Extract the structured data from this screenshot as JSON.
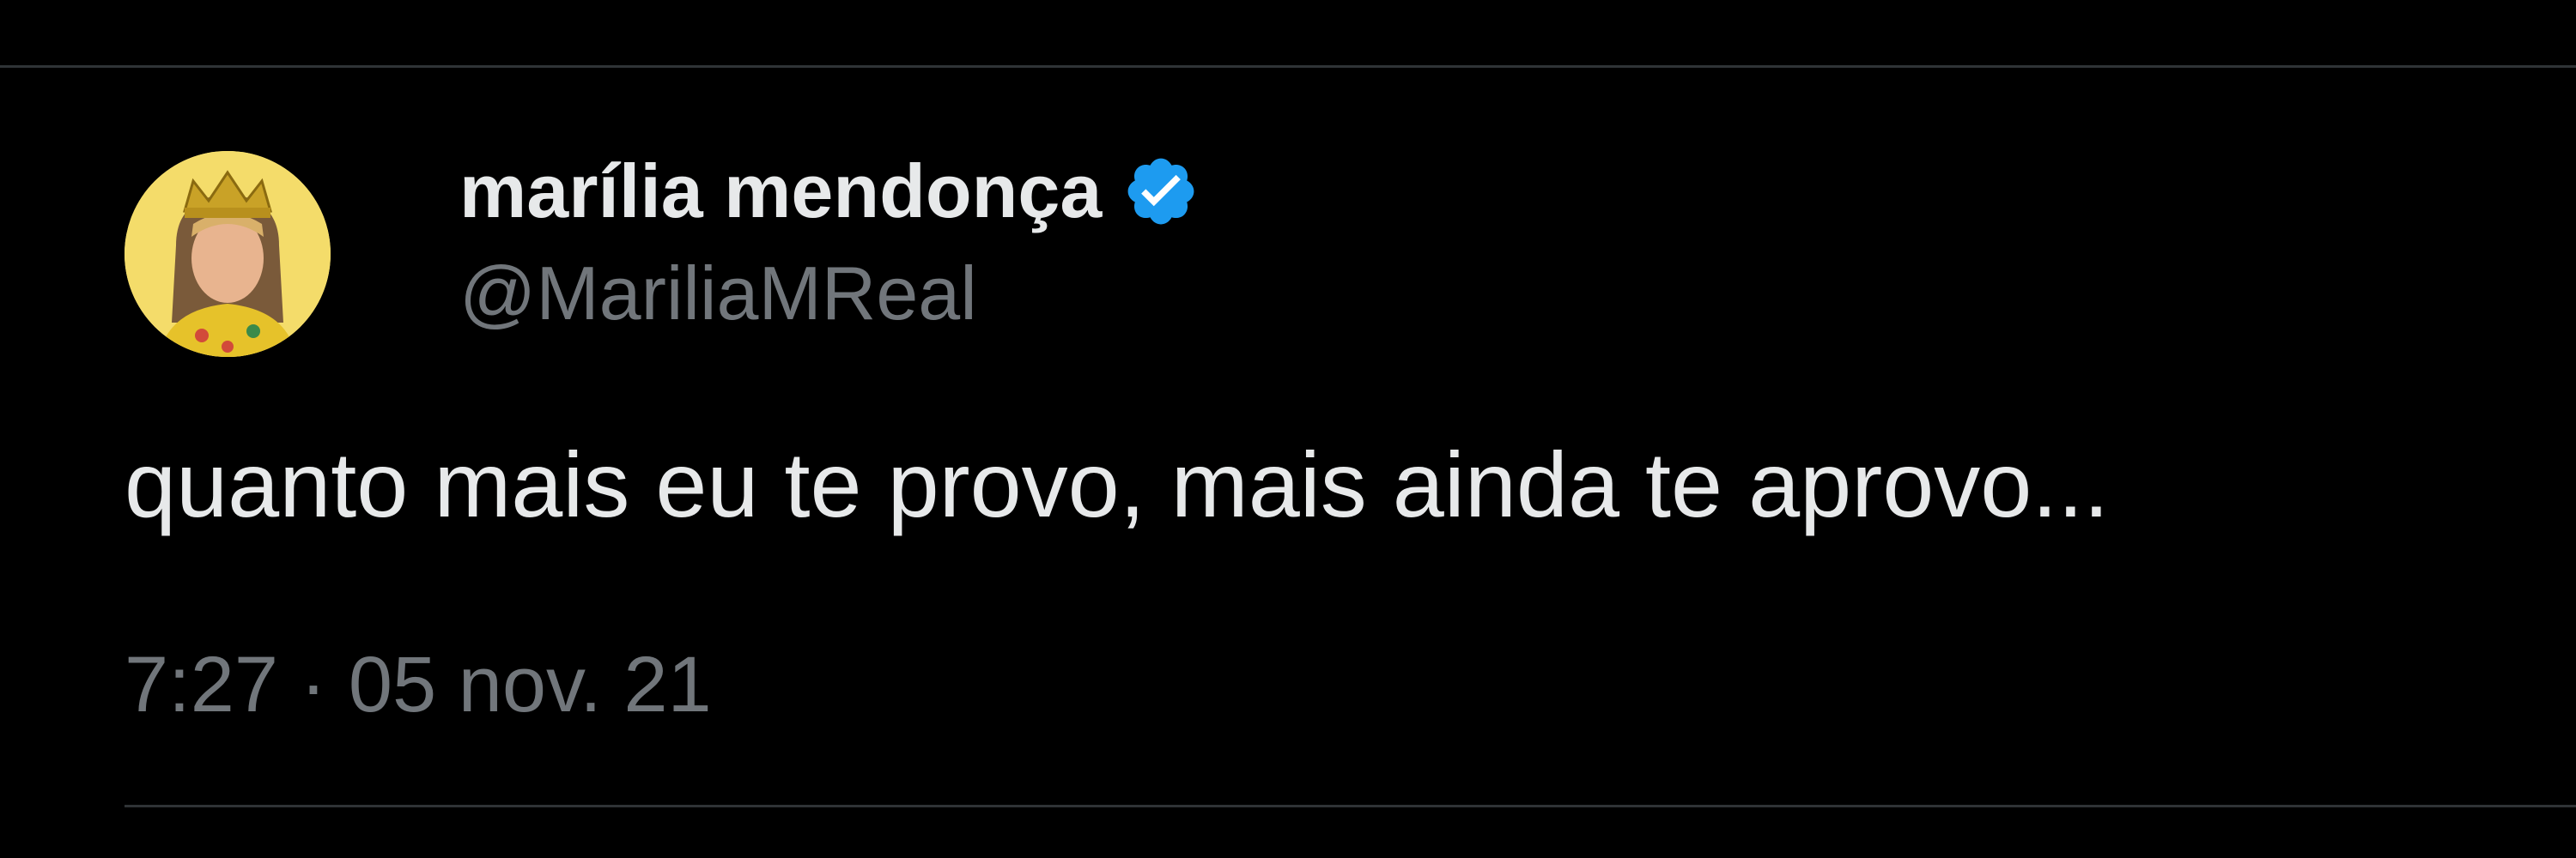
{
  "tweet": {
    "author": {
      "display_name": "marília mendonça",
      "handle": "@MariliaMReal",
      "verified": true,
      "verified_color": "#1d9bf0",
      "avatar_icon": "profile-avatar-crowned"
    },
    "text": "quanto mais eu te provo, mais ainda te aprovo...",
    "time": "7:27",
    "separator": "·",
    "date": "05 nov. 21"
  },
  "theme": {
    "background": "#000000",
    "primary_text": "#e7e9ea",
    "secondary_text": "#71767b",
    "divider": "#2f3336"
  }
}
